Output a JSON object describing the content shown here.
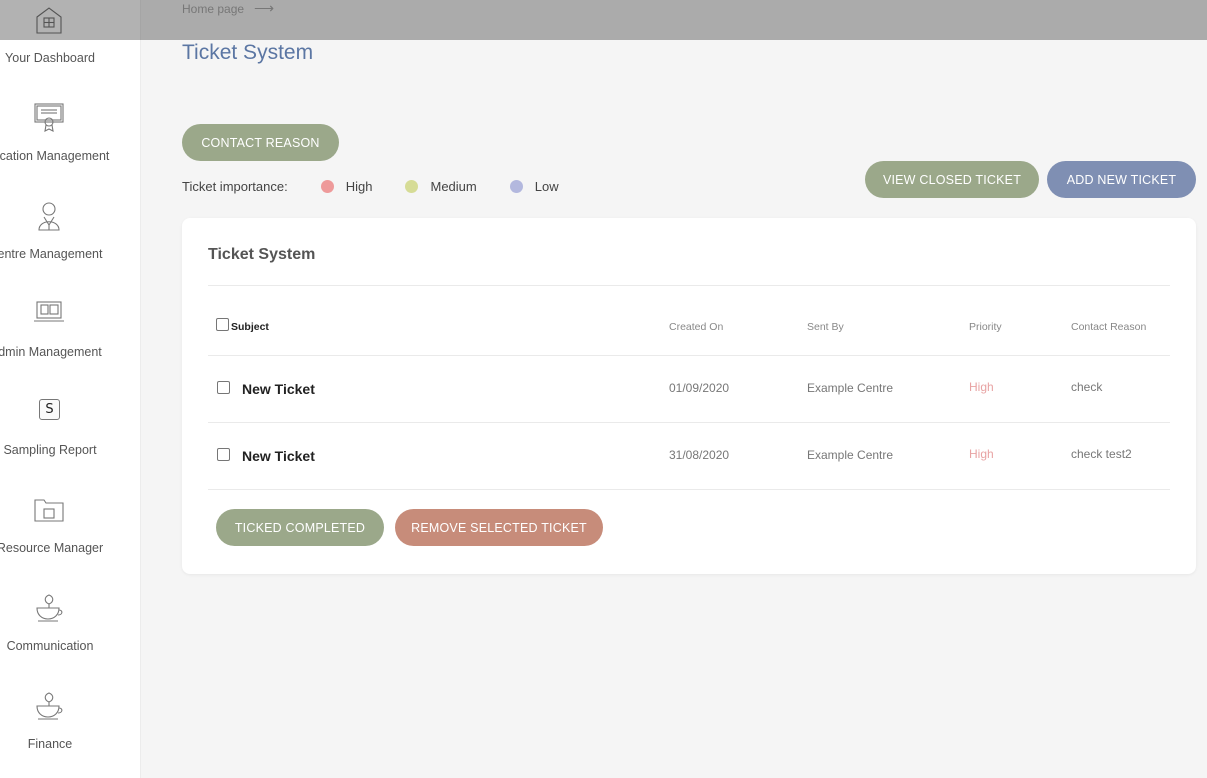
{
  "breadcrumb": {
    "home": "Home page",
    "arrow": "⟶"
  },
  "page": {
    "title": "Ticket System"
  },
  "sidebar": {
    "items": [
      {
        "label": "Your Dashboard",
        "icon": "building-icon"
      },
      {
        "label": "ification Management",
        "icon": "certificate-icon"
      },
      {
        "label": "entre Management",
        "icon": "person-icon"
      },
      {
        "label": "dmin Management",
        "icon": "laptop-icon"
      },
      {
        "label": "Sampling Report",
        "icon": "s-key-icon",
        "glyph": "S"
      },
      {
        "label": "Resource Manager",
        "icon": "folder-icon"
      },
      {
        "label": "Communication",
        "icon": "cup-plant-icon"
      },
      {
        "label": "Finance",
        "icon": "cup-plant-icon"
      }
    ]
  },
  "buttons": {
    "contact_reason": "CONTACT REASON",
    "view_closed": "VIEW CLOSED TICKET",
    "add_new": "ADD NEW TICKET",
    "ticked_completed": "TICKED COMPLETED",
    "remove_selected": "REMOVE SELECTED TICKET"
  },
  "legend": {
    "label": "Ticket importance:",
    "items": [
      {
        "label": "High",
        "color": "#ee9a9a"
      },
      {
        "label": "Medium",
        "color": "#d6dc96"
      },
      {
        "label": "Low",
        "color": "#b3b8de"
      }
    ]
  },
  "card": {
    "title": "Ticket System",
    "columns": {
      "subject": "Subject",
      "created_on": "Created On",
      "sent_by": "Sent By",
      "priority": "Priority",
      "contact_reason": "Contact Reason"
    },
    "rows": [
      {
        "subject": "New Ticket",
        "created_on": "01/09/2020",
        "sent_by": "Example Centre",
        "priority": "High",
        "contact_reason": "check"
      },
      {
        "subject": "New Ticket",
        "created_on": "31/08/2020",
        "sent_by": "Example Centre",
        "priority": "High",
        "contact_reason": "check test2"
      }
    ]
  },
  "colors": {
    "title_blue": "#5b76a3",
    "btn_green": "#9ba88a",
    "btn_blue": "#7f8fb3",
    "btn_red": "#c78c7a",
    "priority_high": "#e8a3a3"
  }
}
